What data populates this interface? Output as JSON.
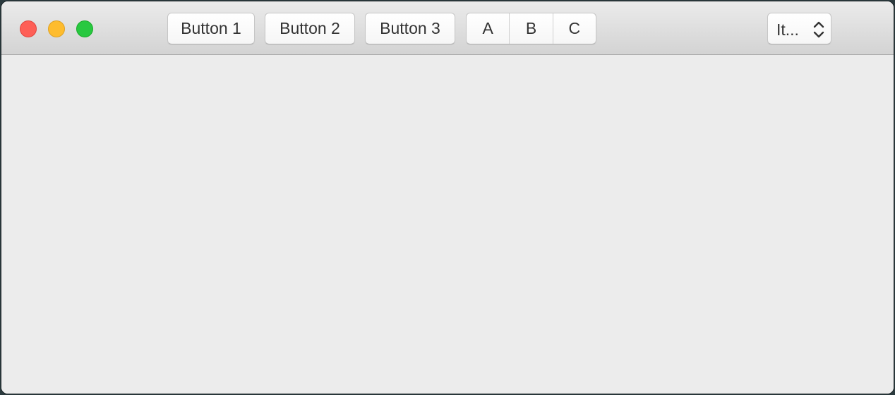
{
  "window": {
    "controls": {
      "close": "close-icon",
      "minimize": "minimize-icon",
      "zoom": "zoom-icon"
    },
    "colors": {
      "close": "#fe5f57",
      "minimize": "#febc2e",
      "zoom": "#28c840"
    }
  },
  "toolbar": {
    "buttons": [
      {
        "label": "Button 1"
      },
      {
        "label": "Button 2"
      },
      {
        "label": "Button 3"
      }
    ],
    "segments": [
      {
        "label": "A"
      },
      {
        "label": "B"
      },
      {
        "label": "C"
      }
    ],
    "popup": {
      "label": "It...",
      "icon": "chevron-up-down-icon"
    }
  }
}
